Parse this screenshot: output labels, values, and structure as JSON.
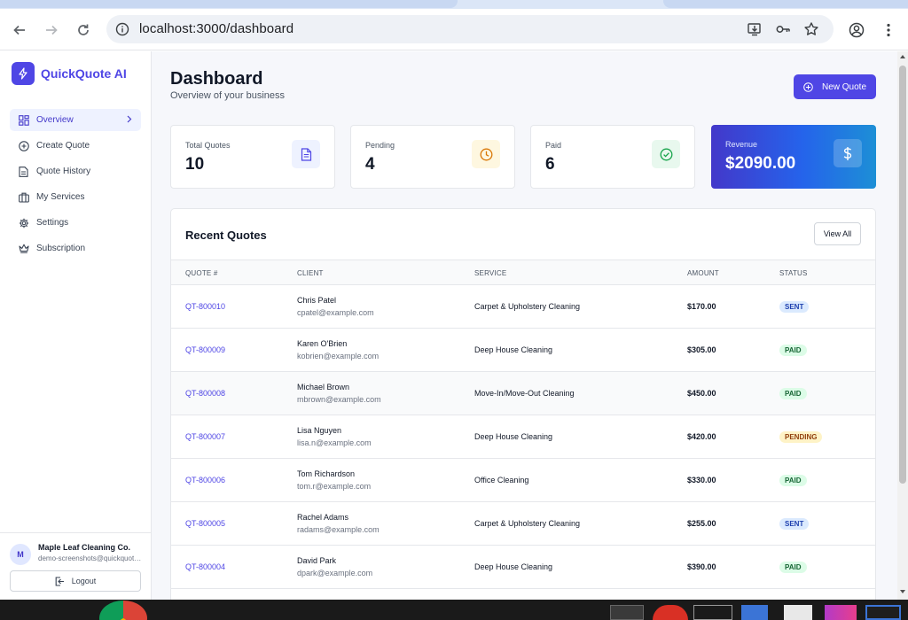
{
  "browser": {
    "url": "localhost:3000/dashboard"
  },
  "sidebar": {
    "brand": "QuickQuote AI",
    "items": [
      {
        "label": "Overview",
        "icon": "grid-icon",
        "active": true
      },
      {
        "label": "Create Quote",
        "icon": "plus-circle-icon"
      },
      {
        "label": "Quote History",
        "icon": "document-icon"
      },
      {
        "label": "My Services",
        "icon": "briefcase-icon"
      },
      {
        "label": "Settings",
        "icon": "gear-icon"
      },
      {
        "label": "Subscription",
        "icon": "crown-icon"
      }
    ],
    "account": {
      "initial": "M",
      "name": "Maple Leaf Cleaning Co.",
      "email": "demo-screenshots@quickquote.ai"
    },
    "logout_label": "Logout"
  },
  "header": {
    "title": "Dashboard",
    "subtitle": "Overview of your business",
    "new_quote_label": "New Quote"
  },
  "stats": [
    {
      "label": "Total Quotes",
      "value": "10",
      "icon": "document-icon",
      "accent": "#4f46e5"
    },
    {
      "label": "Pending",
      "value": "4",
      "icon": "clock-icon",
      "accent": "#d97706"
    },
    {
      "label": "Paid",
      "value": "6",
      "icon": "check-circle-icon",
      "accent": "#16a34a"
    },
    {
      "label": "Revenue",
      "value": "$2090.00",
      "icon": "dollar-icon",
      "accent": "#ffffff"
    }
  ],
  "recent": {
    "title": "Recent Quotes",
    "view_all_label": "View All",
    "columns": [
      "QUOTE #",
      "CLIENT",
      "SERVICE",
      "AMOUNT",
      "STATUS"
    ],
    "rows": [
      {
        "quote": "QT-800010",
        "client": "Chris Patel",
        "email": "cpatel@example.com",
        "service": "Carpet & Upholstery Cleaning",
        "amount": "$170.00",
        "status": "SENT"
      },
      {
        "quote": "QT-800009",
        "client": "Karen O'Brien",
        "email": "kobrien@example.com",
        "service": "Deep House Cleaning",
        "amount": "$305.00",
        "status": "PAID"
      },
      {
        "quote": "QT-800008",
        "client": "Michael Brown",
        "email": "mbrown@example.com",
        "service": "Move-In/Move-Out Cleaning",
        "amount": "$450.00",
        "status": "PAID"
      },
      {
        "quote": "QT-800007",
        "client": "Lisa Nguyen",
        "email": "lisa.n@example.com",
        "service": "Deep House Cleaning",
        "amount": "$420.00",
        "status": "PENDING"
      },
      {
        "quote": "QT-800006",
        "client": "Tom Richardson",
        "email": "tom.r@example.com",
        "service": "Office Cleaning",
        "amount": "$330.00",
        "status": "PAID"
      },
      {
        "quote": "QT-800005",
        "client": "Rachel Adams",
        "email": "radams@example.com",
        "service": "Carpet & Upholstery Cleaning",
        "amount": "$255.00",
        "status": "SENT"
      },
      {
        "quote": "QT-800004",
        "client": "David Park",
        "email": "dpark@example.com",
        "service": "Deep House Cleaning",
        "amount": "$390.00",
        "status": "PAID"
      },
      {
        "quote": "",
        "client": "",
        "email": "",
        "service": "",
        "amount": "",
        "status": ""
      }
    ]
  },
  "colors": {
    "brand": "#4f46e5",
    "sent_badge": "#dbeafe",
    "paid_badge": "#dcfce7",
    "pending_badge": "#fef3c7"
  }
}
